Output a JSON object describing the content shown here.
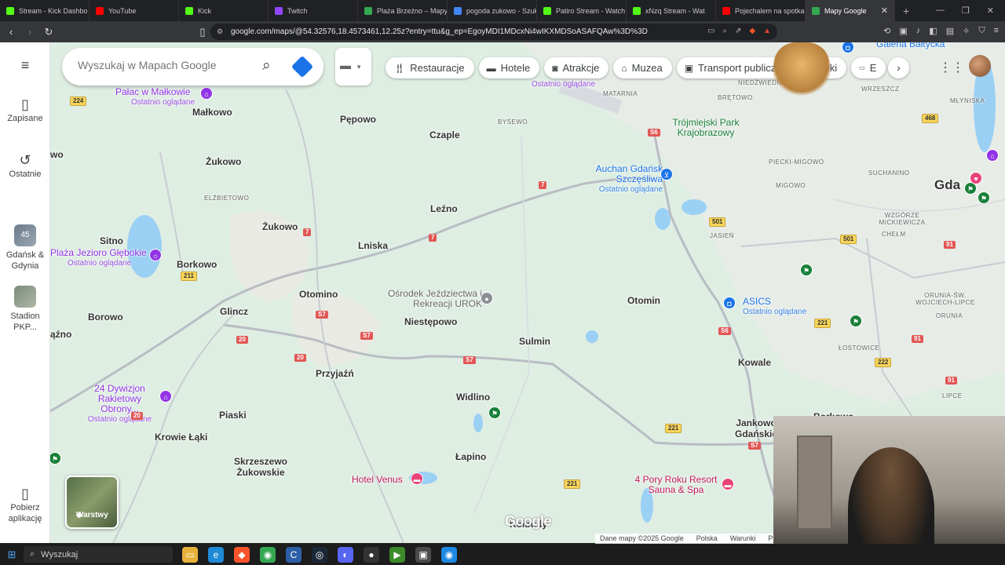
{
  "browser": {
    "tabs": [
      {
        "label": "Stream - Kick Dashbo",
        "color": "#53fc18"
      },
      {
        "label": "YouTube",
        "color": "#ff0000"
      },
      {
        "label": "Kick",
        "color": "#53fc18"
      },
      {
        "label": "Twitch",
        "color": "#9146ff"
      },
      {
        "label": "Plaża Brzeźno – Mapy",
        "color": "#34a853"
      },
      {
        "label": "pogoda zukowo - Szuk",
        "color": "#4285f4"
      },
      {
        "label": "Patiro Stream - Watch",
        "color": "#53fc18"
      },
      {
        "label": "xNzq Stream - Wat",
        "color": "#53fc18"
      },
      {
        "label": "Pojechalem na spotka",
        "color": "#ff0000"
      },
      {
        "label": "Mapy Google",
        "color": "#34a853",
        "active": true
      }
    ],
    "url": "google.com/maps/@54.32576,18.4573461,12.25z?entry=ttu&g_ep=EgoyMDI1MDcxNi4wIKXMDSoASAFQAw%3D%3D"
  },
  "sidebar": {
    "saved": "Zapisane",
    "recent": "Ostatnie",
    "item1": "Gdańsk & Gdynia",
    "item1_badge": "45",
    "item2": "Stadion PKP...",
    "download": "Pobierz aplikację"
  },
  "search": {
    "placeholder": "Wyszukaj w Mapach Google"
  },
  "chips": [
    "Restauracje",
    "Hotele",
    "Atrakcje",
    "Muzea",
    "Transport publiczny",
    "Apteki",
    "E"
  ],
  "map": {
    "places": [
      "Małkowo",
      "Pępowo",
      "Czaple",
      "Żukowo",
      "ELŻBIETOWO",
      "Żukowo",
      "Leźno",
      "Lniska",
      "Sitno",
      "Borkowo",
      "Otomino",
      "Niestępowo",
      "Glincz",
      "Borowo",
      "Sulmin",
      "Otomin",
      "Przyjaźń",
      "Widlino",
      "Piaski",
      "Krowie Łąki",
      "Skrzeszewo Żukowskie",
      "Łapino",
      "Kowale",
      "Jankowo Gdańskie",
      "Gda",
      "BYSEWO",
      "MATARNIA",
      "BRĘTOWO",
      "NIEDŹWIEDNIK",
      "WRZESZCZ",
      "PIECKI-MIGOWO",
      "MIGOWO",
      "SUCHANINO",
      "WZGÓRZE MICKIEWICZA",
      "JASIEŃ",
      "CHEŁM",
      "ŁOSTOWICE",
      "ORUNIA",
      "ORUNIA-ŚW. WOJCIECH-LIPCE",
      "LIPCE",
      "MŁYNISKA",
      "ąźno",
      "wo",
      "Borkowo",
      "Kolbudy"
    ],
    "pois": {
      "palac": "Pałac w Małkowie",
      "palac_sub": "Ostatnio oglądane",
      "plaza": "Plaża Jezioro Głębokie",
      "plaza_sub": "Ostatnio oglądane",
      "osrodek": "Ośrodek Jeździectwa i Rekreacji UROK",
      "dywizjon": "24 Dywizjon Rakietowy Obrony...",
      "dywizjon_sub": "Ostatnio oglądane",
      "auchan": "Auchan Gdańsk Szczęśliwa",
      "auchan_sub": "Ostatnio oglądane",
      "park": "Trójmiejski Park Krajobrazowy",
      "asics": "ASICS",
      "asics_sub": "Ostatnio oglądane",
      "venus": "Hotel Venus",
      "pory": "4 Pory Roku Resort Sauna & Spa",
      "galeria": "Galeria Bałtycka",
      "recent_top": "Ostatnio oglądane"
    },
    "roads": [
      "224",
      "7",
      "7",
      "7",
      "211",
      "S7",
      "S7",
      "S7",
      "20",
      "20",
      "20",
      "S6",
      "S6",
      "501",
      "501",
      "91",
      "91",
      "91",
      "468",
      "221",
      "221",
      "221",
      "222",
      "S7"
    ],
    "layers_label": "Warstwy",
    "google_logo": "Google",
    "footer": [
      "Dane mapy ©2025 Google",
      "Polska",
      "Warunki",
      "Pryw"
    ]
  },
  "taskbar": {
    "search": "Wyszukaj"
  },
  "colors": {
    "map_bg": "#dfeee3",
    "accent": "#1a73e8",
    "poi_purple": "#9334e6",
    "road_red": "#e15755"
  }
}
